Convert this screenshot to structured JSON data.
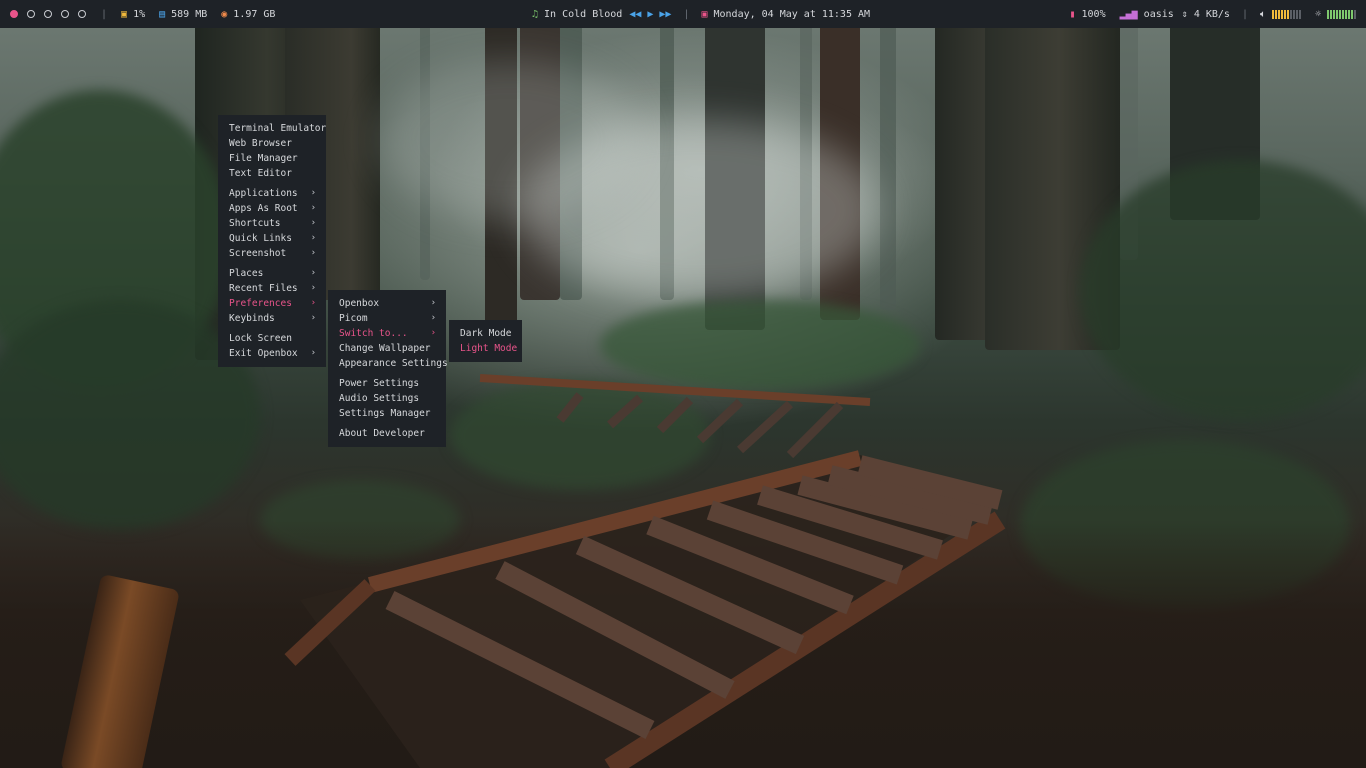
{
  "topbar": {
    "workspaces": [
      {
        "name": "workspace-1",
        "active": true
      },
      {
        "name": "workspace-2",
        "active": false
      },
      {
        "name": "workspace-3",
        "active": false
      },
      {
        "name": "workspace-4",
        "active": false
      },
      {
        "name": "workspace-5",
        "active": false
      }
    ],
    "cpu": {
      "icon": "cpu-icon",
      "value": "1%"
    },
    "memory": {
      "icon": "memory-icon",
      "value": "589 MB"
    },
    "disk": {
      "icon": "disk-icon",
      "value": "1.97 GB"
    },
    "music": {
      "icon": "music-note-icon",
      "title": "In Cold Blood"
    },
    "date": {
      "icon": "calendar-icon",
      "value": "Monday, 04 May at 11:35 AM"
    },
    "battery": {
      "icon": "battery-icon",
      "value": "100%"
    },
    "network": {
      "icon": "signal-icon",
      "ssid": "oasis",
      "speed": "4 KB/s"
    },
    "volume": {
      "icon": "speaker-icon",
      "level": 0.6
    },
    "brightness": {
      "icon": "brightness-icon",
      "level": 0.9
    },
    "colors": {
      "accent": "#e8548a",
      "bar_bg": "#1e2227",
      "volume_bars": "#f0b93b",
      "brightness_bars": "#7ec86d",
      "music_icon": "#7ec86d",
      "media_controls": "#4aa3e8"
    }
  },
  "root_menu": {
    "items": [
      {
        "label": "Terminal Emulator",
        "submenu": false
      },
      {
        "label": "Web Browser",
        "submenu": false
      },
      {
        "label": "File Manager",
        "submenu": false
      },
      {
        "label": "Text Editor",
        "submenu": false
      },
      {
        "separator": true
      },
      {
        "label": "Applications",
        "submenu": true
      },
      {
        "label": "Apps As Root",
        "submenu": true
      },
      {
        "label": "Shortcuts",
        "submenu": true
      },
      {
        "label": "Quick Links",
        "submenu": true
      },
      {
        "label": "Screenshot",
        "submenu": true
      },
      {
        "separator": true
      },
      {
        "label": "Places",
        "submenu": true
      },
      {
        "label": "Recent Files",
        "submenu": true
      },
      {
        "label": "Preferences",
        "submenu": true,
        "highlighted": true
      },
      {
        "label": "Keybinds",
        "submenu": true
      },
      {
        "separator": true
      },
      {
        "label": "Lock Screen",
        "submenu": false
      },
      {
        "label": "Exit Openbox",
        "submenu": true
      }
    ]
  },
  "preferences_menu": {
    "items": [
      {
        "label": "Openbox",
        "submenu": true
      },
      {
        "label": "Picom",
        "submenu": true
      },
      {
        "label": "Switch to...",
        "submenu": true,
        "highlighted": true
      },
      {
        "label": "Change Wallpaper",
        "submenu": false
      },
      {
        "label": "Appearance Settings",
        "submenu": false
      },
      {
        "separator": true
      },
      {
        "label": "Power Settings",
        "submenu": false
      },
      {
        "label": "Audio Settings",
        "submenu": false
      },
      {
        "label": "Settings Manager",
        "submenu": false
      },
      {
        "separator": true
      },
      {
        "label": "About Developer",
        "submenu": false
      }
    ]
  },
  "switch_menu": {
    "items": [
      {
        "label": "Dark Mode",
        "submenu": false
      },
      {
        "label": "Light Mode",
        "submenu": false,
        "highlighted": true
      }
    ]
  }
}
